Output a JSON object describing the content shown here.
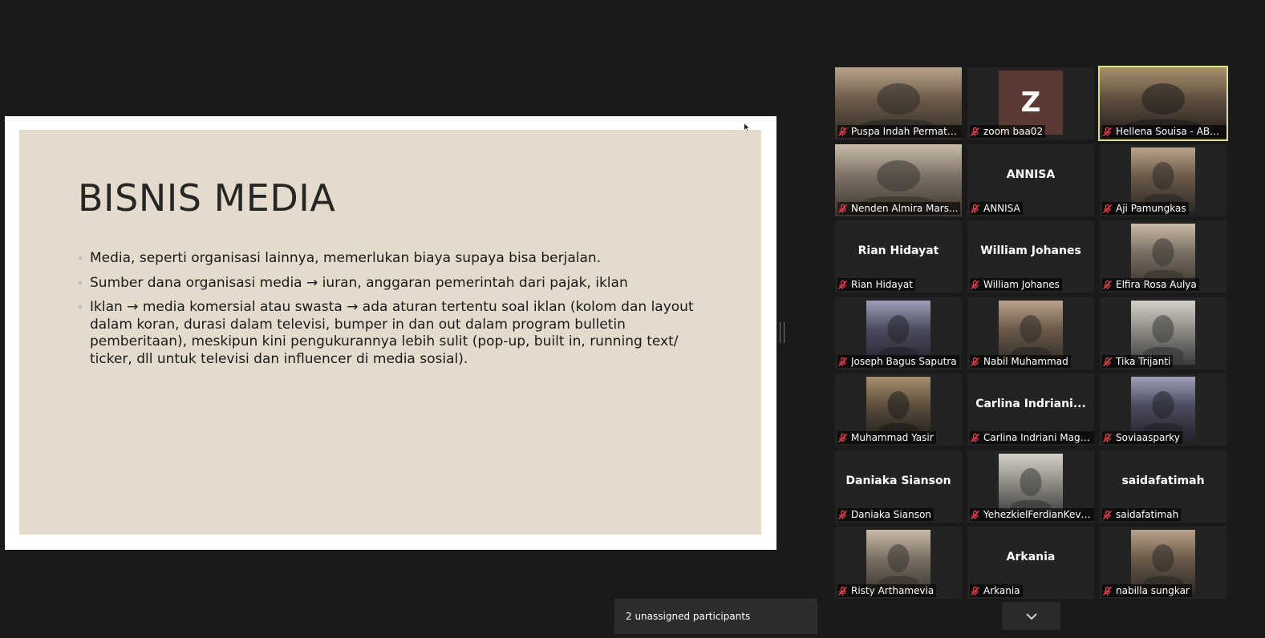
{
  "slide": {
    "title": "BISNIS MEDIA",
    "bullets": [
      "Media, seperti organisasi lainnya, memerlukan biaya supaya bisa berjalan.",
      "Sumber dana organisasi media → iuran, anggaran pemerintah dari pajak, iklan",
      "Iklan → media komersial atau swasta → ada aturan tertentu soal iklan (kolom dan layout dalam koran, durasi dalam televisi, bumper in dan out dalam program bulletin pemberitaan), meskipun kini pengukurannya lebih sulit (pop-up, built in, running text/ ticker, dll untuk televisi dan influencer di media sosial)."
    ],
    "bullet_glyph": "◦"
  },
  "participants": [
    {
      "label": "Puspa Indah Permata...",
      "video": "photo"
    },
    {
      "label": "zoom baa02",
      "avatar_letter": "Z"
    },
    {
      "label": "Hellena Souisa - ABC Ne...",
      "video": "photo",
      "active_speaker": true
    },
    {
      "label": "Nenden Almira Mars...",
      "video": "photo"
    },
    {
      "label": "ANNISA",
      "display_name": "ANNISA"
    },
    {
      "label": "Aji Pamungkas",
      "video": "photo"
    },
    {
      "label": "Rian Hidayat",
      "display_name": "Rian Hidayat"
    },
    {
      "label": "William Johanes",
      "display_name": "William Johanes"
    },
    {
      "label": "Elfira Rosa Aulya",
      "video": "photo"
    },
    {
      "label": "Joseph Bagus Saputra",
      "video": "photo"
    },
    {
      "label": "Nabil Muhammad",
      "video": "photo"
    },
    {
      "label": "Tika Trijanti",
      "video": "photo"
    },
    {
      "label": "Muhammad Yasir",
      "video": "photo"
    },
    {
      "label": "Carlina Indriani Magd...",
      "display_name": "Carlina  Indriani..."
    },
    {
      "label": "Soviaasparky",
      "video": "photo"
    },
    {
      "label": "Daniaka Sianson",
      "display_name": "Daniaka Sianson"
    },
    {
      "label": "YehezkielFerdianKevin...",
      "video": "photo"
    },
    {
      "label": "saidafatimah",
      "display_name": "saidafatimah"
    },
    {
      "label": "Risty Arthamevia",
      "video": "photo"
    },
    {
      "label": "Arkania",
      "display_name": "Arkania"
    },
    {
      "label": "nabilla sungkar",
      "video": "photo"
    }
  ],
  "footer": {
    "unassigned_text": "2 unassigned participants"
  },
  "colors": {
    "background": "#1a1a1a",
    "tile": "#232323",
    "active_speaker_border": "#d9e272",
    "mute": "#e0404a",
    "slide_bg": "#e4dbcc"
  },
  "icons": {
    "mute": "microphone-muted-icon",
    "scroll": "chevron-down-icon",
    "cursor": "mouse-pointer-icon"
  }
}
